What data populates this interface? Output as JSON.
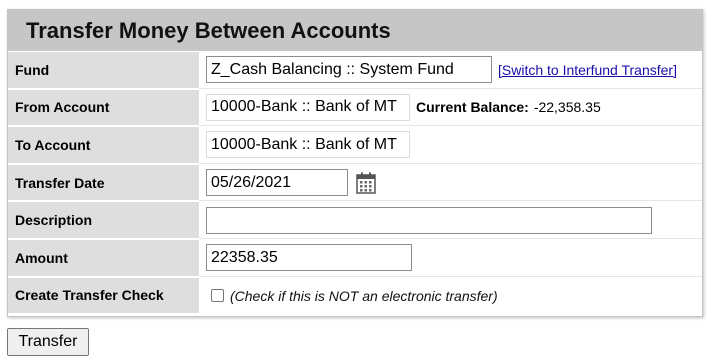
{
  "panel": {
    "title": "Transfer Money Between Accounts"
  },
  "fund": {
    "label": "Fund",
    "value": "Z_Cash Balancing :: System Fund",
    "switch_link": "[Switch to Interfund Transfer]"
  },
  "from_account": {
    "label": "From Account",
    "value": "10000-Bank :: Bank of MT",
    "balance_label": "Current Balance:",
    "balance_value": "-22,358.35"
  },
  "to_account": {
    "label": "To Account",
    "value": "10000-Bank :: Bank of MT"
  },
  "transfer_date": {
    "label": "Transfer Date",
    "value": "05/26/2021",
    "icon": "calendar-icon"
  },
  "description": {
    "label": "Description",
    "value": ""
  },
  "amount": {
    "label": "Amount",
    "value": "22358.35"
  },
  "create_check": {
    "label": "Create Transfer Check",
    "checked": false,
    "note": "(Check if this is NOT an electronic transfer)"
  },
  "actions": {
    "transfer_label": "Transfer"
  },
  "colors": {
    "title_bg": "#c6c6c6",
    "label_bg": "#dedede",
    "link": "#1a0dab"
  }
}
